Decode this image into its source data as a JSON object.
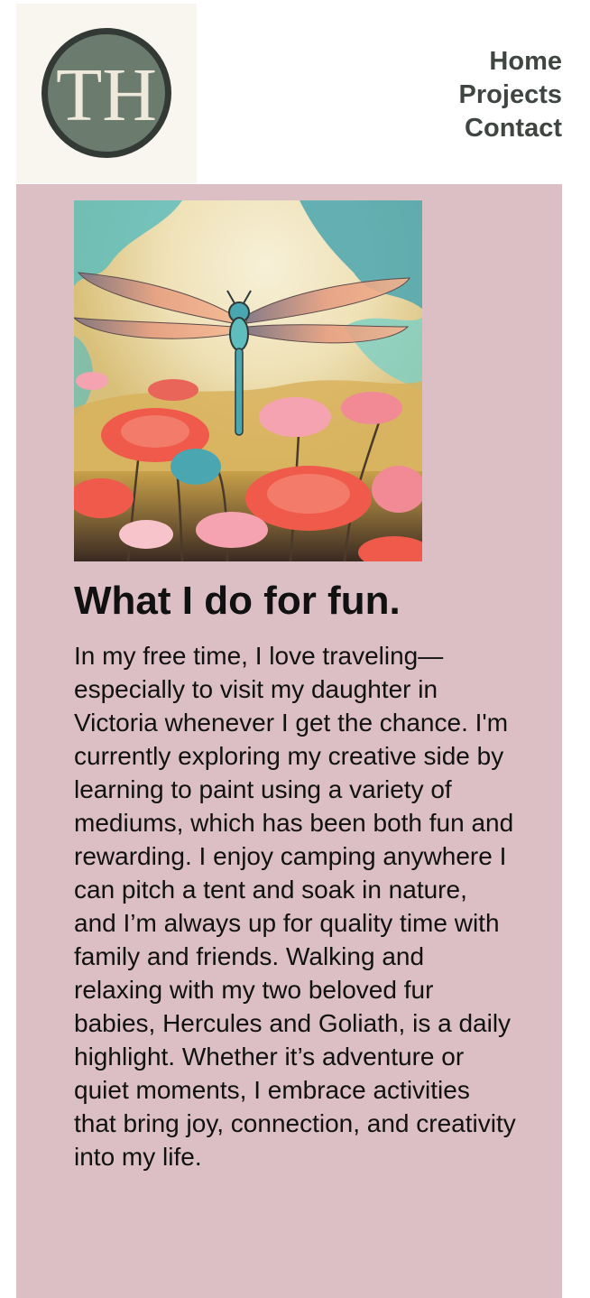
{
  "header": {
    "logo": {
      "monogram": "TH",
      "ring_color": "#333a35",
      "fill_color": "#6b7b6e",
      "text_color": "#efe9dc",
      "background": "#f9f6ef"
    },
    "nav": [
      {
        "label": "Home"
      },
      {
        "label": "Projects"
      },
      {
        "label": "Contact"
      }
    ],
    "nav_color": "#3f4642"
  },
  "main": {
    "background": "#dbbfc5",
    "image": {
      "subject": "dragonfly-painting",
      "palette": [
        "#f3e7c4",
        "#5fbdbd",
        "#ef5a4b",
        "#f5a3b1",
        "#c9a14a",
        "#4aa6b0"
      ]
    },
    "heading": "What I do for fun.",
    "paragraph": "In my free time, I love traveling—especially to visit my daughter in Victoria whenever I get the chance. I'm currently exploring my creative side by learning to paint using a variety of mediums, which has been both fun and rewarding. I enjoy camping anywhere I can pitch a tent and soak in nature, and I’m always up for quality time with family and friends. Walking and relaxing with my two beloved fur babies, Hercules and Goliath, is a daily highlight. Whether it’s adventure or quiet moments, I embrace activities that bring joy, connection, and creativity into my life."
  }
}
